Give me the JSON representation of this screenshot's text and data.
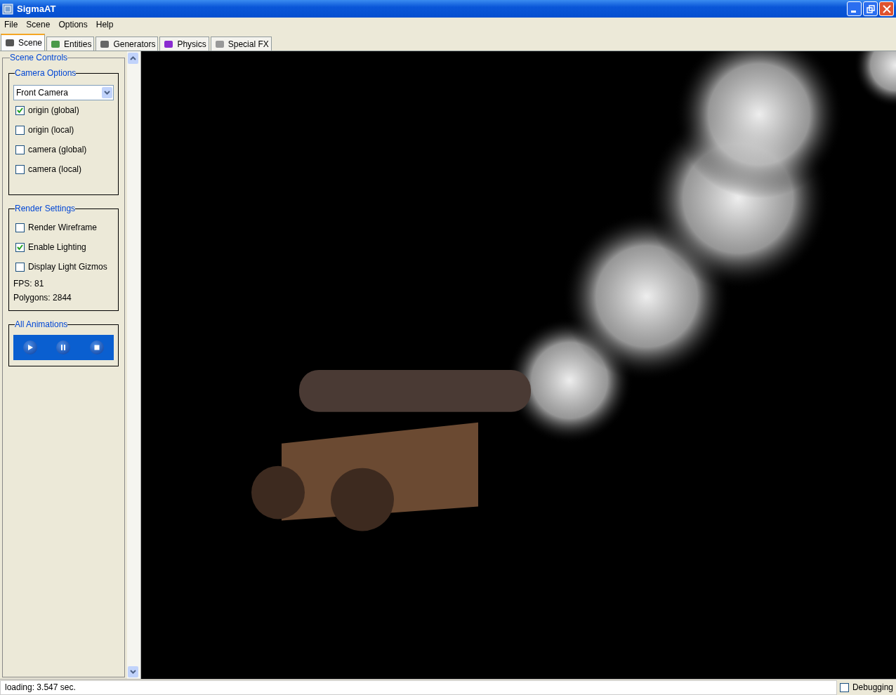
{
  "window": {
    "title": "SigmaAT"
  },
  "menu": [
    "File",
    "Scene",
    "Options",
    "Help"
  ],
  "tabs": [
    {
      "label": "Scene",
      "selected": true
    },
    {
      "label": "Entities",
      "selected": false
    },
    {
      "label": "Generators",
      "selected": false
    },
    {
      "label": "Physics",
      "selected": false
    },
    {
      "label": "Special FX",
      "selected": false
    }
  ],
  "scene_controls": {
    "title": "Scene Controls",
    "camera_options": {
      "title": "Camera Options",
      "camera": "Front Camera",
      "checkboxes": [
        {
          "label": "origin (global)",
          "checked": true
        },
        {
          "label": "origin (local)",
          "checked": false
        },
        {
          "label": "camera (global)",
          "checked": false
        },
        {
          "label": "camera (local)",
          "checked": false
        }
      ]
    },
    "render_settings": {
      "title": "Render Settings",
      "checkboxes": [
        {
          "label": "Render Wireframe",
          "checked": false
        },
        {
          "label": "Enable Lighting",
          "checked": true
        },
        {
          "label": "Display Light Gizmos",
          "checked": false
        }
      ],
      "fps": "FPS: 81",
      "polygons": "Polygons: 2844"
    },
    "all_animations": {
      "title": "All Animations"
    }
  },
  "status_bar": {
    "text": "loading: 3.547 sec.",
    "debugging": {
      "label": "Debugging",
      "checked": false
    }
  }
}
